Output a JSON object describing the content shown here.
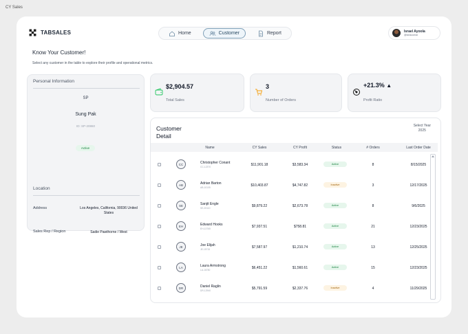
{
  "caption": "CY Sales",
  "brand": {
    "name": "TABSALES",
    "icon": "puzzle-logo-icon"
  },
  "nav": {
    "items": [
      {
        "label": "Home",
        "icon": "home-icon",
        "active": false
      },
      {
        "label": "Customer",
        "icon": "users-icon",
        "active": true
      },
      {
        "label": "Report",
        "icon": "document-icon",
        "active": false
      }
    ]
  },
  "user": {
    "name": "Israel Ayoola",
    "handle": "@isrlaoomai"
  },
  "page": {
    "title": "Know Your Customer!",
    "subtitle": "Select any customer in the table to explore their profile and operational metrics."
  },
  "profile": {
    "section_title": "Personal Information",
    "initials": "SP",
    "name": "Sung Pak",
    "id": "ID: SP-20860",
    "status": "Active",
    "location_title": "Location",
    "address_label": "Address",
    "address_value": "Los Angeles, California, 90036 United States",
    "rep_label": "Sales Rep / Region",
    "rep_value": "Sadie Pawthorne / West"
  },
  "stats": {
    "sales": {
      "value": "$2,904.57",
      "label": "Total Sales",
      "icon": "wallet-icon",
      "color": "#22c55e"
    },
    "orders": {
      "value": "3",
      "label": "Number of Orders",
      "icon": "cart-icon",
      "color": "#f59e0b"
    },
    "profit": {
      "value": "+21.3%",
      "label": "Profit Ratio",
      "icon": "gauge-icon",
      "trend_icon": "triangle-up-icon"
    }
  },
  "table": {
    "title": "Customer\nDetail",
    "select_year_label": "Select Year",
    "selected_year": "2025",
    "columns": [
      "Name",
      "CY Sales",
      "CY Profit",
      "Status",
      "# Orders",
      "Last Order Date"
    ],
    "rows": [
      {
        "initials": "CC",
        "name": "Christopher Conant",
        "id": "CC-12370",
        "sales": "$11,901.18",
        "profit": "$3,583.34",
        "status": "Active",
        "orders": "8",
        "date": "8/15/2025"
      },
      {
        "initials": "AB",
        "name": "Adrian Barton",
        "id": "AB-10105",
        "sales": "$10,403.87",
        "profit": "$4,747.82",
        "status": "Inactive",
        "orders": "3",
        "date": "12/17/2025"
      },
      {
        "initials": "SE",
        "name": "Sanjit Engle",
        "id": "SE-20110",
        "sales": "$9,879.22",
        "profit": "$2,673.78",
        "status": "Active",
        "orders": "8",
        "date": "9/6/2025"
      },
      {
        "initials": "EH",
        "name": "Edward Hooks",
        "id": "EH-13765",
        "sales": "$7,937.51",
        "profit": "$758.81",
        "status": "Active",
        "orders": "21",
        "date": "12/23/2025"
      },
      {
        "initials": "JE",
        "name": "Joe Elijah",
        "id": "JE-15715",
        "sales": "$7,587.97",
        "profit": "$1,210.74",
        "status": "Active",
        "orders": "13",
        "date": "12/25/2025"
      },
      {
        "initials": "LA",
        "name": "Laura Armstrong",
        "id": "LA-16780",
        "sales": "$6,451.22",
        "profit": "$1,560.61",
        "status": "Active",
        "orders": "15",
        "date": "12/23/2025"
      },
      {
        "initials": "DR",
        "name": "Daniel Raglin",
        "id": "DR-12940",
        "sales": "$5,791.59",
        "profit": "$2,337.76",
        "status": "Inactive",
        "orders": "4",
        "date": "11/29/2025"
      }
    ]
  }
}
